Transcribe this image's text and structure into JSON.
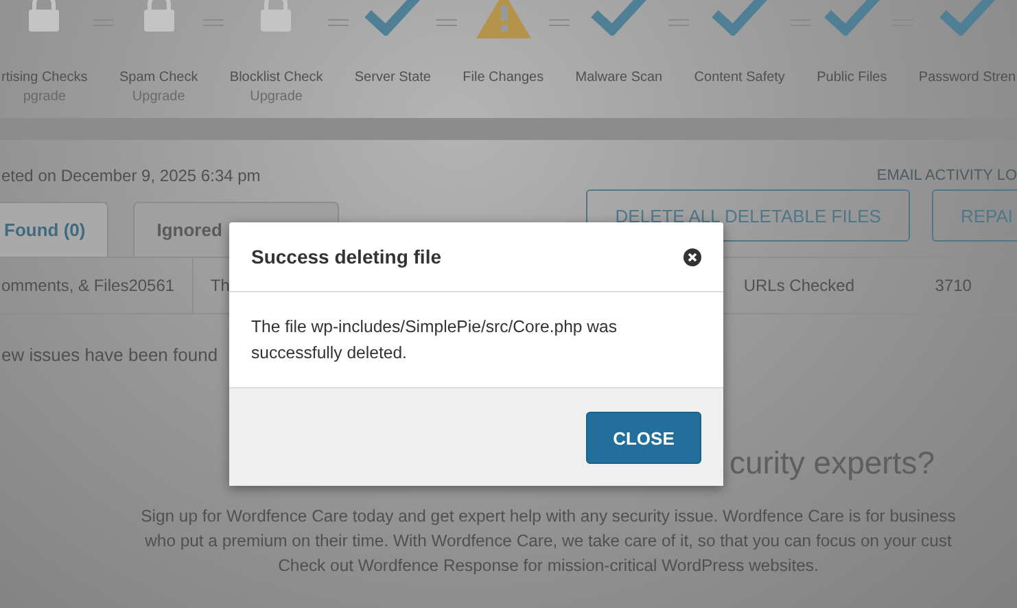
{
  "stages": [
    {
      "label": "rtising Checks",
      "sublabel": "pgrade",
      "kind": "locked"
    },
    {
      "label": "Spam Check",
      "sublabel": "Upgrade",
      "kind": "locked"
    },
    {
      "label": "Blocklist Check",
      "sublabel": "Upgrade",
      "kind": "locked"
    },
    {
      "label": "Server State",
      "kind": "check"
    },
    {
      "label": "File Changes",
      "kind": "warning"
    },
    {
      "label": "Malware Scan",
      "kind": "check"
    },
    {
      "label": "Content Safety",
      "kind": "check"
    },
    {
      "label": "Public Files",
      "kind": "check"
    },
    {
      "label": "Password Stren",
      "kind": "check"
    }
  ],
  "scan": {
    "completed": "eted on December 9, 2025 6:34 pm",
    "email_link": "EMAIL ACTIVITY LO"
  },
  "tabs": [
    {
      "label": "Found (0)",
      "selected": true
    },
    {
      "label": "Ignored",
      "selected": false
    }
  ],
  "actions": [
    "DELETE ALL DELETABLE FILES",
    "REPAI"
  ],
  "stats": [
    "omments, & Files20561",
    "Th",
    "URLs Checked",
    "3710"
  ],
  "notice": "ew issues have been found",
  "promo": {
    "heading": "curity experts?",
    "lines": [
      "Sign up for Wordfence Care today and get expert help with any security issue. Wordfence Care is for business",
      "who put a premium on their time. With Wordfence Care, we take care of it, so that you can focus on your cust",
      "Check out Wordfence Response for mission-critical WordPress websites."
    ]
  },
  "dialog": {
    "title": "Success deleting file",
    "message": "The file wp-includes/SimplePie/src/Core.php was successfully deleted.",
    "button": "CLOSE"
  }
}
